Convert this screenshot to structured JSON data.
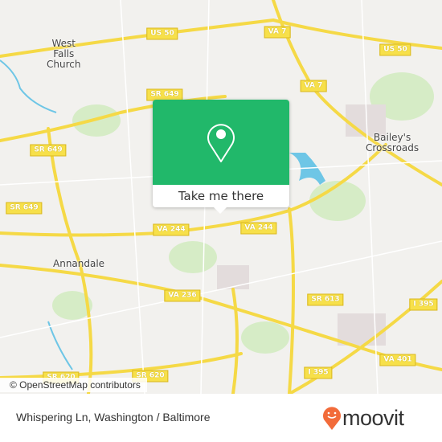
{
  "map": {
    "places": [
      {
        "name": "West Falls Church",
        "lines": [
          "West",
          "Falls",
          "Church"
        ]
      },
      {
        "name": "Bailey's Crossroads",
        "lines": [
          "Bailey's",
          "Crossroads"
        ]
      },
      {
        "name": "Annandale",
        "lines": [
          "Annandale"
        ]
      }
    ],
    "shields": [
      "US 50",
      "VA 7",
      "US 50",
      "VA 7",
      "SR 649",
      "SR 649",
      "SR 649",
      "VA 244",
      "VA 244",
      "VA 236",
      "SR 613",
      "I 395",
      "VA 401",
      "I 395",
      "SR 620",
      "SR 620"
    ],
    "attribution": "© OpenStreetMap contributors",
    "colors": {
      "road": "#f7e04a",
      "water": "#6ec6e6",
      "park": "#d4ecc4",
      "land": "#f2f1ee"
    }
  },
  "popup": {
    "icon": "location-pin-icon",
    "button_label": "Take me there",
    "color": "#21b86a"
  },
  "footer": {
    "title": "Whispering Ln, Washington / Baltimore",
    "brand": "moovit",
    "brand_color": "#f26b3a"
  }
}
